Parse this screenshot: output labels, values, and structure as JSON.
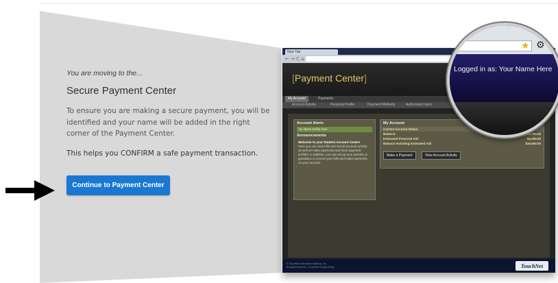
{
  "intro_label": "You are moving to the...",
  "title": "Secure Payment Center",
  "description": "To ensure you are making a secure payment, you will be identified and your name will be added in the right corner of the Payment Center.",
  "confirm_text": "This helps you CONFIRM a safe payment transaction.",
  "continue_button": "Continue to Payment Center",
  "colors": {
    "button_blue": "#1a77d2",
    "panel_gray": "#d9d9d9",
    "app_title_gold": "#e7c86a"
  },
  "preview": {
    "browser_tab": "New Tab",
    "nav_glyphs": "← → C ⌂ ☰",
    "app_title": "Payment Center",
    "tabs": [
      "My Account",
      "Payments"
    ],
    "subnav": [
      "Account Activity",
      "Personal Profile",
      "Payment Methods",
      "Authorized Users"
    ],
    "alerts": {
      "title": "Account Alerts",
      "message": "No alerts at this time."
    },
    "announcements": {
      "title": "Announcements",
      "heading": "Welcome to your Student Account Center!",
      "body": "Here you can view bills and recent account activity as well as make payments and store payment profiles. In addition, you can set up your parents or guardians to access your bills and make payments on your account."
    },
    "my_account": {
      "title": "My Account",
      "status_title": "Current Account Status",
      "rows": [
        {
          "label": "Balance:",
          "value": "$20,750.00"
        },
        {
          "label": "Estimated Financial Aid:",
          "value": "$4,250.00"
        },
        {
          "label": "Balance Including Estimated Aid:",
          "value": "$16,500.00"
        }
      ],
      "buttons": [
        "Make a Payment",
        "View Account Activity"
      ]
    },
    "footer_lines": [
      "© TouchNet Information Systems, Inc.",
      "All rights reserved. | TouchNet Privacy Policy"
    ],
    "logo": "TouchNet",
    "magnifier": {
      "logged_in": "Logged in as: Your Name Here",
      "star_icon": "star-icon",
      "gear_icon": "gear-icon"
    }
  }
}
